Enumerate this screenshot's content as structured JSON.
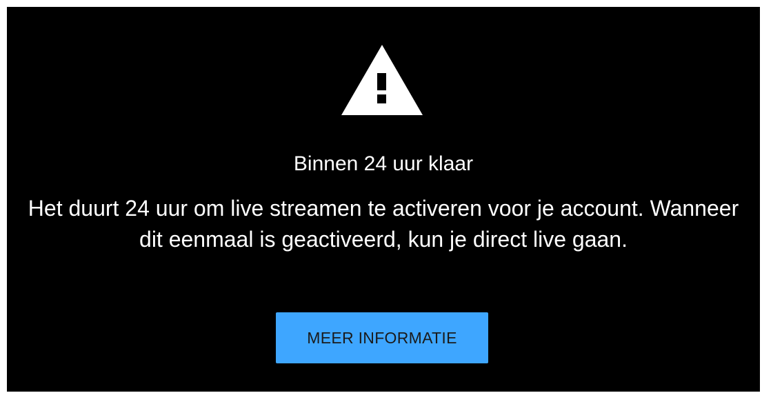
{
  "dialog": {
    "icon": "warning-triangle-icon",
    "title": "Binnen 24 uur klaar",
    "message": "Het duurt 24 uur om live streamen te activeren voor je account. Wanneer dit eenmaal is geactiveerd, kun je direct live gaan.",
    "button_label": "MEER INFORMATIE"
  },
  "colors": {
    "background": "#000000",
    "text": "#ffffff",
    "button_background": "#3ea6ff",
    "button_text": "#1a1a1a"
  }
}
